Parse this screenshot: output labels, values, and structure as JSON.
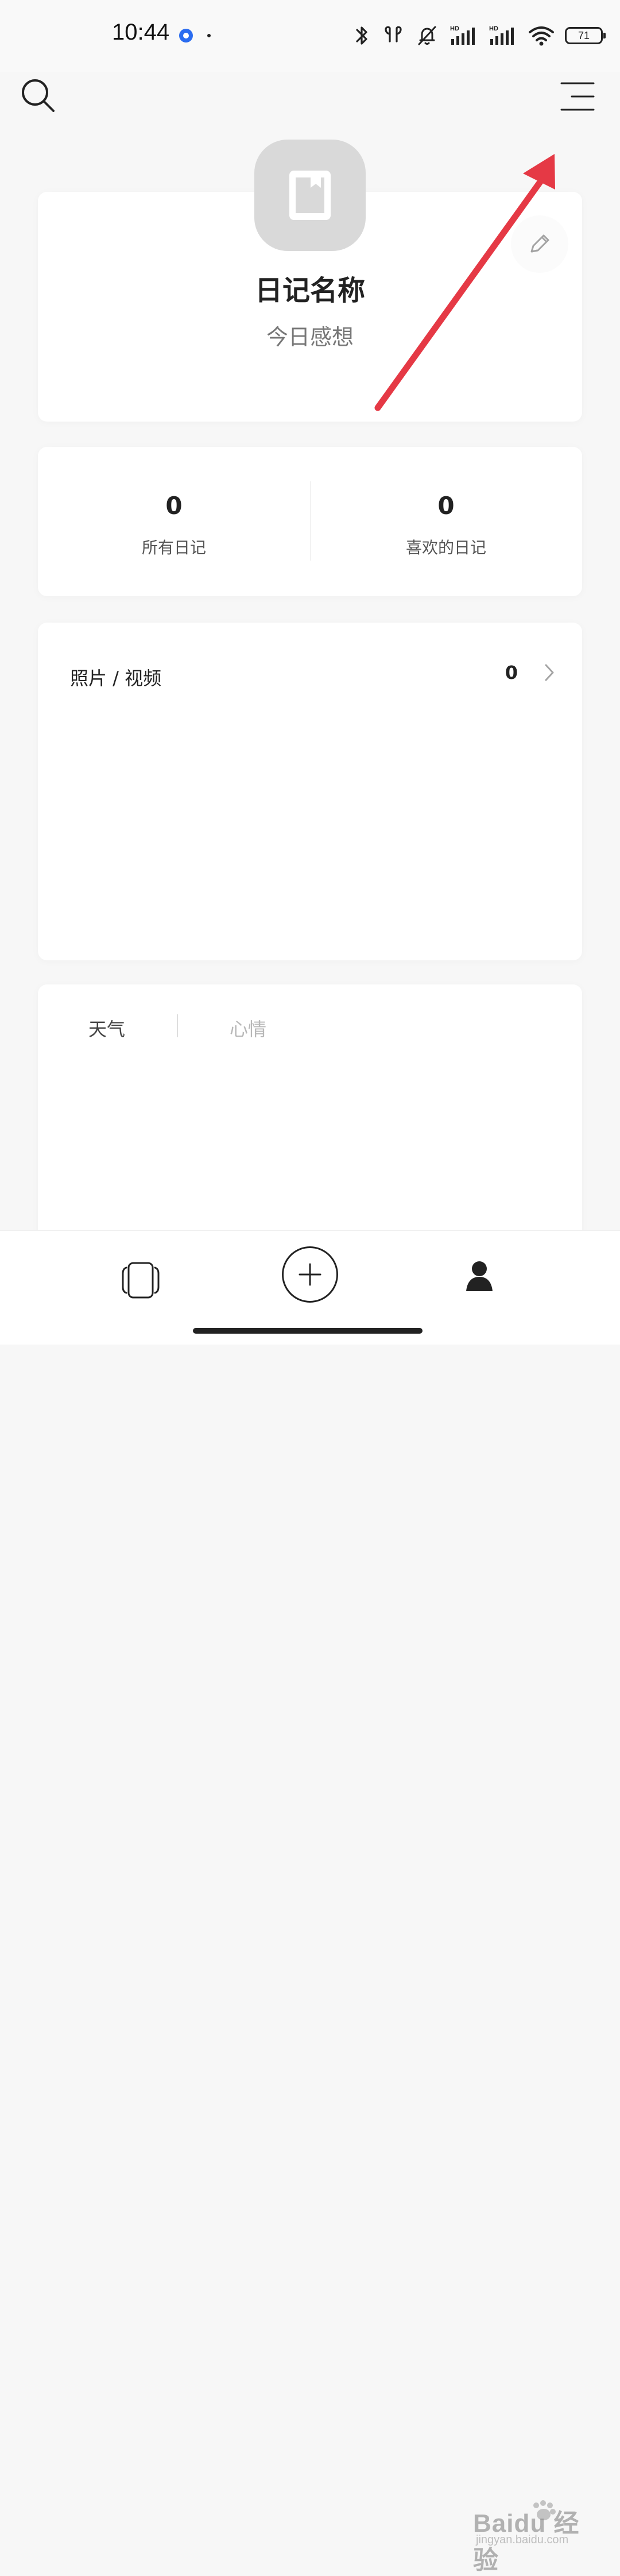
{
  "status_bar": {
    "time": "10:44",
    "battery_level": "71",
    "network_labels": [
      "HD",
      "HD"
    ],
    "icons": [
      "app-dot-icon",
      "bluetooth-icon",
      "earbuds-icon",
      "silent-icon",
      "signal-icon",
      "signal-icon",
      "wifi-icon",
      "battery-icon"
    ]
  },
  "header": {
    "search_icon": "search-icon",
    "menu_icon": "menu-icon"
  },
  "profile": {
    "diary_title": "日记名称",
    "diary_subtitle": "今日感想",
    "avatar_icon": "book-icon",
    "edit_icon": "pencil-icon"
  },
  "stats": [
    {
      "value": "0",
      "label": "所有日记"
    },
    {
      "value": "0",
      "label": "喜欢的日记"
    }
  ],
  "media": {
    "title": "照片 / 视频",
    "count": "0"
  },
  "mood_tabs": [
    "天气",
    "心情"
  ],
  "bottom_nav": {
    "left_icon": "cards-icon",
    "center_icon": "plus-icon",
    "right_icon": "profile-icon"
  },
  "watermark": {
    "main": "Baidu 经验",
    "sub": "jingyan.baidu.com"
  },
  "colors": {
    "annotation_arrow": "#e53945",
    "avatar_background": "#d9d9d9",
    "page_background": "#f7f7f7"
  }
}
